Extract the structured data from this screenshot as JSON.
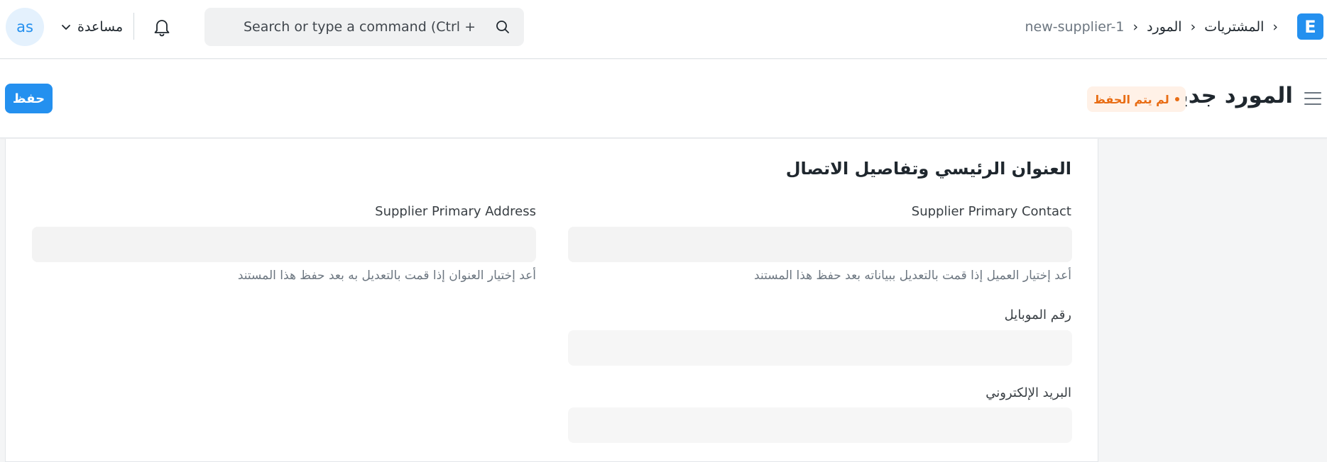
{
  "navbar": {
    "brand_letter": "E",
    "breadcrumbs": [
      "المشتريات",
      "المورد",
      "new-supplier-1"
    ],
    "breadcrumb_separator": "›",
    "search": {
      "placeholder": "Search or type a command (Ctrl + G)"
    },
    "help_label": "مساعدة",
    "avatar_initials": "as"
  },
  "page_head": {
    "title": "المورد جديد",
    "status_badge": "لم يتم الحفظ",
    "save_label": "حفظ"
  },
  "form": {
    "section_title": "العنوان الرئيسي وتفاصيل الاتصال",
    "fields": {
      "primary_contact": {
        "label": "Supplier Primary Contact",
        "value": "",
        "help": "أعد إختيار العميل إذا قمت بالتعديل ببياناته بعد حفظ هذا المستند"
      },
      "primary_address": {
        "label": "Supplier Primary Address",
        "value": "",
        "help": "أعد إختيار العنوان إذا قمت بالتعديل به بعد حفظ هذا المستند"
      },
      "mobile_no": {
        "label": "رقم الموبايل",
        "value": ""
      },
      "email_id": {
        "label": "البريد الإلكتروني",
        "value": ""
      }
    }
  },
  "colors": {
    "accent": "#2490ef",
    "status_orange": "#e86c13",
    "status_badge_bg": "#fff1e7",
    "page_bg": "#f4f5f6"
  },
  "icons": {
    "search": "search-icon",
    "notifications": "bell-icon",
    "dropdown": "chevron-down-icon",
    "sidebar_toggle": "menu-icon"
  }
}
